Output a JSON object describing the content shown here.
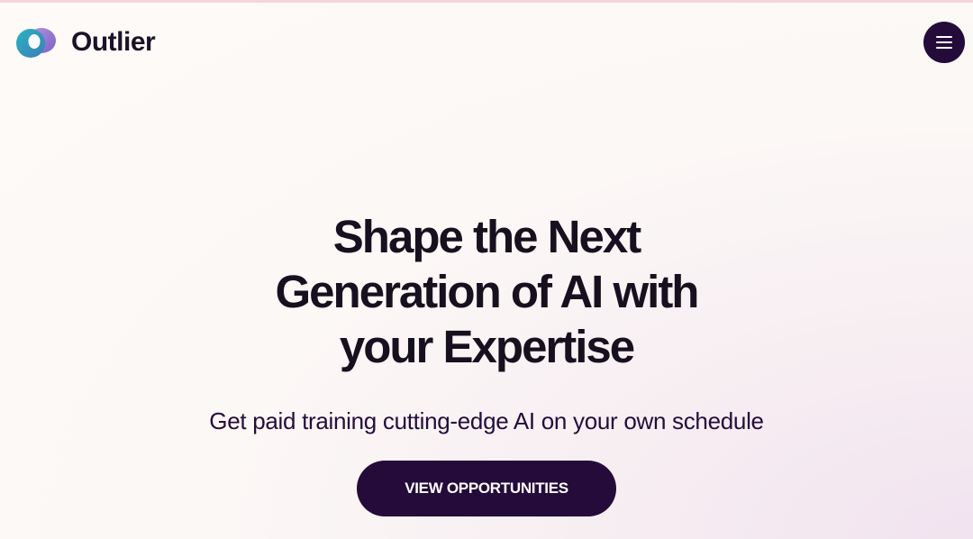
{
  "header": {
    "brand_name": "Outlier",
    "logo_icon": "outlier-logo-icon",
    "menu_icon": "hamburger-menu-icon"
  },
  "hero": {
    "headline_lines": [
      "Shape the Next",
      "Generation of AI with",
      "your Expertise"
    ],
    "subheadline": "Get paid training cutting-edge AI on your own schedule",
    "cta_label": "VIEW OPPORTUNITIES"
  },
  "colors": {
    "primary_dark": "#240b3a",
    "headline_text": "#17111f",
    "background": "#fdfaf8",
    "logo_teal": "#2a9fb0",
    "logo_purple": "#8a63c9"
  }
}
